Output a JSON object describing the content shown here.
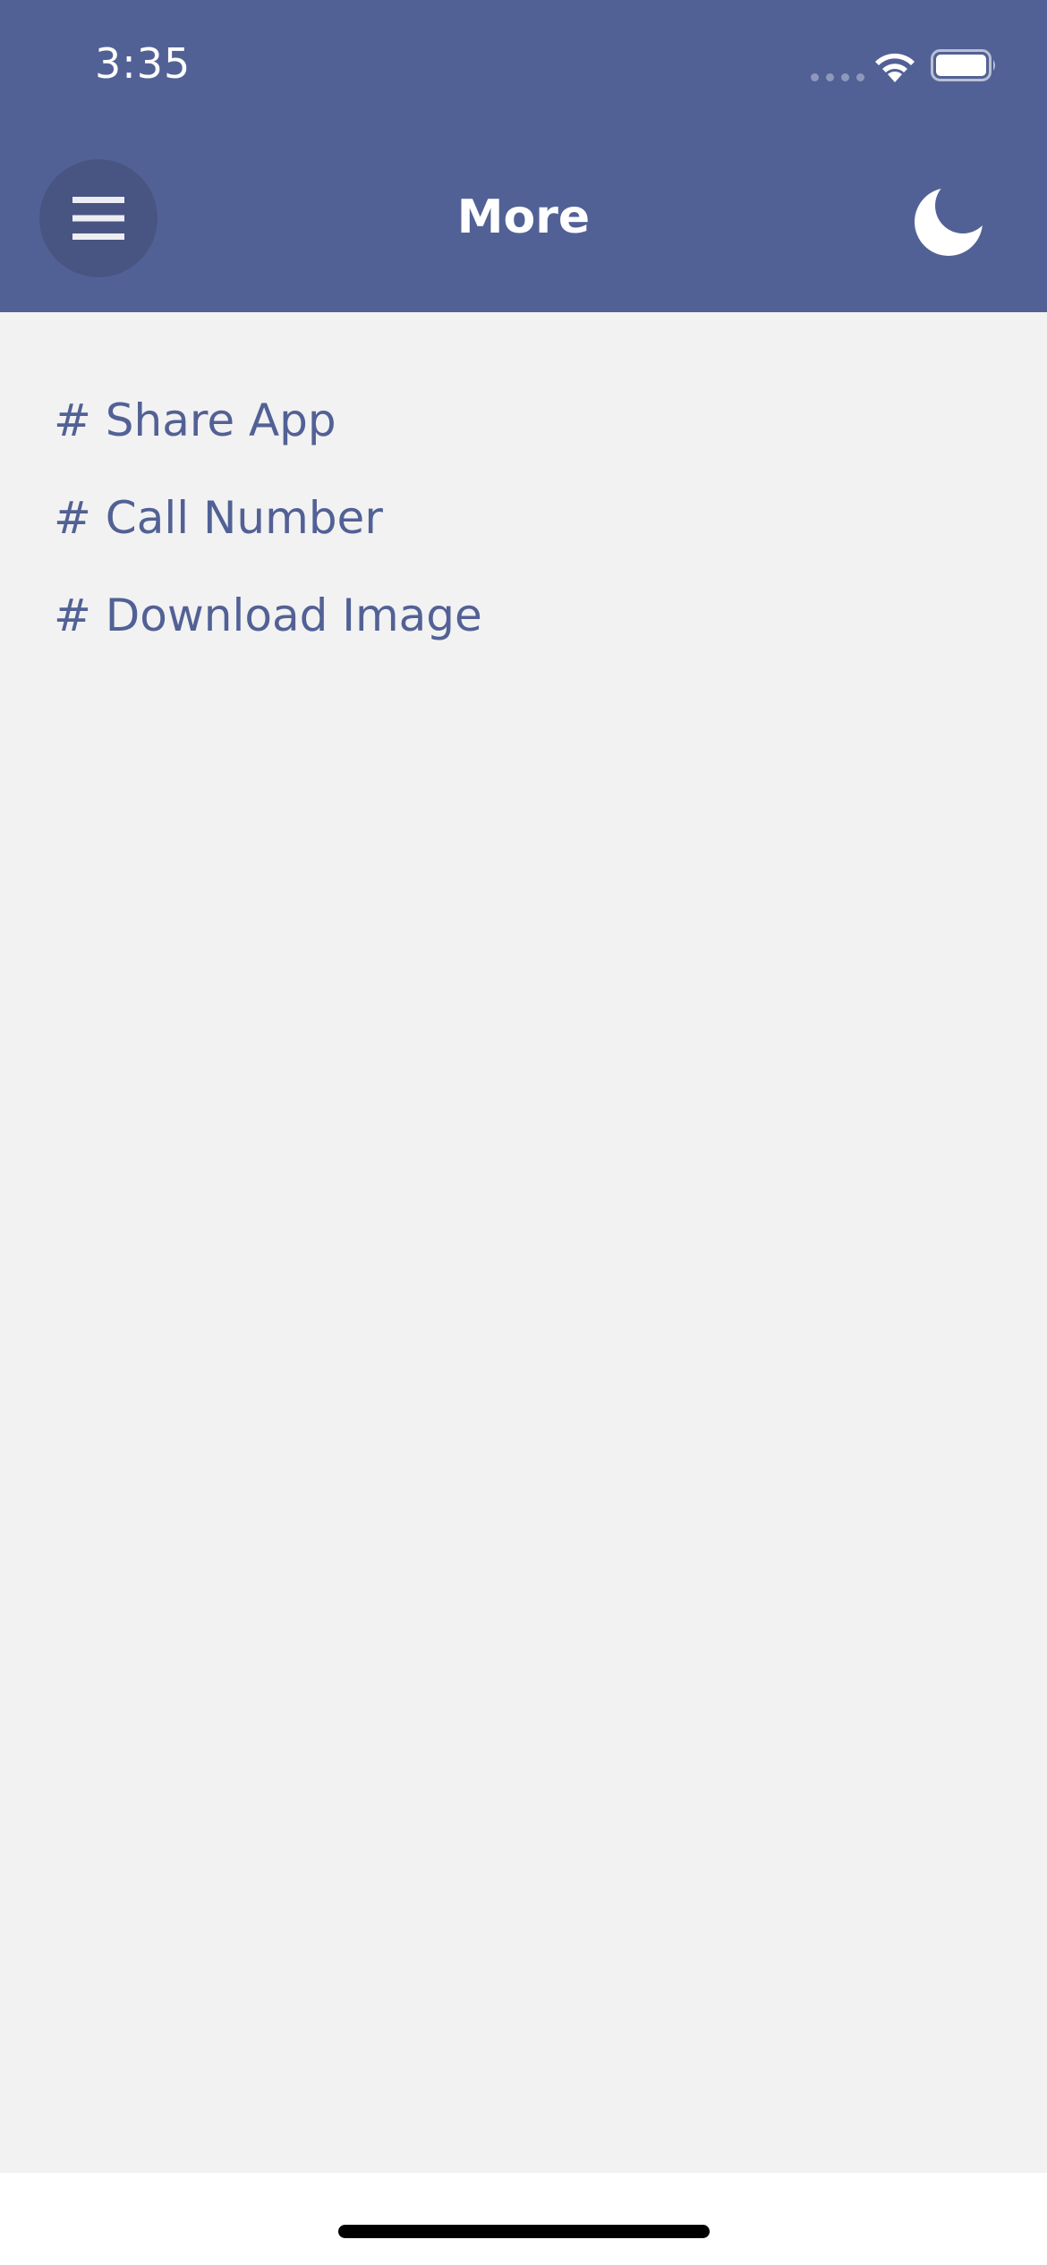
{
  "status_bar": {
    "time": "3:35"
  },
  "header": {
    "title": "More",
    "menu_icon": "hamburger-menu-icon",
    "theme_icon": "moon-icon"
  },
  "menu": {
    "items": [
      {
        "label": "# Share App"
      },
      {
        "label": "# Call Number"
      },
      {
        "label": "# Download Image"
      }
    ]
  },
  "colors": {
    "header_bg": "#526195",
    "content_bg": "#f2f2f2",
    "link_text": "#526195"
  }
}
